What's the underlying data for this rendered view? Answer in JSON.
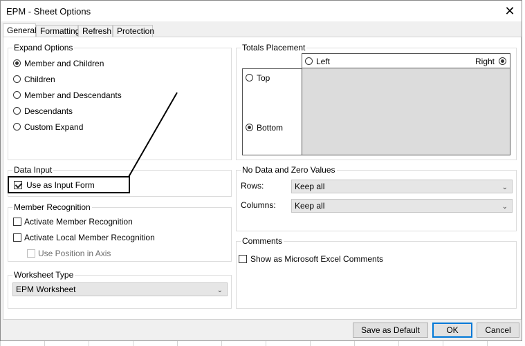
{
  "window": {
    "title": "EPM - Sheet Options",
    "close_glyph": "✕"
  },
  "tabs": [
    {
      "label": "General",
      "active": true
    },
    {
      "label": "Formatting",
      "active": false
    },
    {
      "label": "Refresh",
      "active": false
    },
    {
      "label": "Protection",
      "active": false
    }
  ],
  "expand_options": {
    "legend": "Expand Options",
    "items": [
      {
        "label": "Member and Children",
        "selected": true
      },
      {
        "label": "Children",
        "selected": false
      },
      {
        "label": "Member and Descendants",
        "selected": false
      },
      {
        "label": "Descendants",
        "selected": false
      },
      {
        "label": "Custom Expand",
        "selected": false
      }
    ]
  },
  "totals_placement": {
    "legend": "Totals Placement",
    "left": "Left",
    "right": "Right",
    "top": "Top",
    "bottom": "Bottom",
    "horizontal_selected": "Right",
    "vertical_selected": "Bottom"
  },
  "data_input": {
    "legend": "Data Input",
    "use_as_input_form": "Use as Input Form",
    "checked": true
  },
  "member_recognition": {
    "legend": "Member Recognition",
    "activate": "Activate Member Recognition",
    "activate_local": "Activate Local Member Recognition",
    "use_position": "Use Position in Axis"
  },
  "worksheet_type": {
    "legend": "Worksheet Type",
    "value": "EPM Worksheet"
  },
  "no_data": {
    "legend": "No Data and Zero Values",
    "rows_label": "Rows:",
    "rows_value": "Keep all",
    "columns_label": "Columns:",
    "columns_value": "Keep all"
  },
  "comments": {
    "legend": "Comments",
    "show_excel": "Show as Microsoft Excel Comments"
  },
  "buttons": {
    "save_default": "Save as Default",
    "ok": "OK",
    "cancel": "Cancel"
  },
  "colors": {
    "focus_border": "#0078d7",
    "dialog_bg": "#f0f0f0",
    "placement_fill": "#dcdcdc"
  }
}
